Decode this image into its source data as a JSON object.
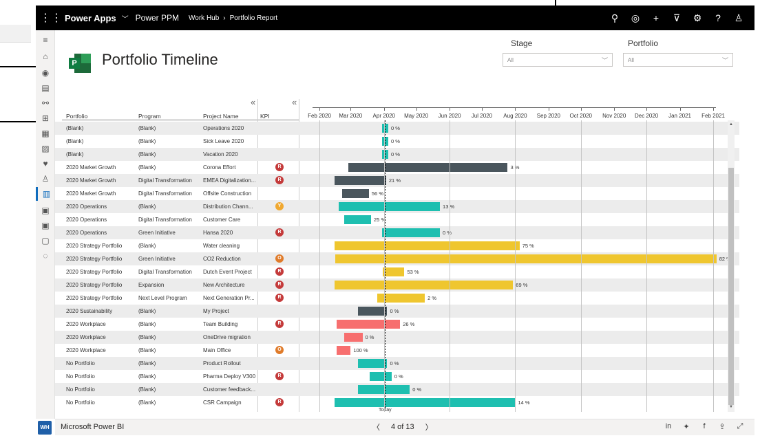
{
  "topbar": {
    "app_name": "Power Apps",
    "env_name": "Power PPM",
    "crumb_1": "Work Hub",
    "crumb_2": "Portfolio Report",
    "icons": [
      "search-icon",
      "assistant-icon",
      "add-icon",
      "filter-icon",
      "settings-icon",
      "help-icon",
      "user-icon"
    ]
  },
  "rail": {
    "avatar_initials": "WH",
    "items": [
      "hamburger-icon",
      "home-icon",
      "circle-icon",
      "document-icon",
      "hierarchy-icon",
      "table-icon",
      "grid-icon",
      "image-icon",
      "heart-icon",
      "person-icon",
      "report-icon",
      "clipboard-icon",
      "clipboard-icon",
      "page-icon",
      "check-circle-icon"
    ]
  },
  "report": {
    "title": "Portfolio Timeline",
    "stage_label": "Stage",
    "stage_value": "All",
    "portfolio_label": "Portfolio",
    "portfolio_value": "All",
    "headers": {
      "portfolio": "Portfolio",
      "program": "Program",
      "project": "Project Name",
      "kpi": "KPI"
    },
    "months": [
      "Feb 2020",
      "Mar 2020",
      "Apr 2020",
      "May 2020",
      "Jun 2020",
      "Jul 2020",
      "Aug 2020",
      "Sep 2020",
      "Oct 2020",
      "Nov 2020",
      "Dec 2020",
      "Jan 2021",
      "Feb 2021"
    ],
    "today_label": "Today",
    "colors": {
      "teal": "#1ebfb0",
      "dark": "#4a565d",
      "yellow": "#efc62f",
      "red": "#f76f6f",
      "kpi_red": "#c43a3a",
      "kpi_orange": "#e07b2a",
      "kpi_yellow": "#f0a830"
    },
    "rows": [
      {
        "portfolio": "(Blank)",
        "program": "(Blank)",
        "project": "Operations 2020",
        "kpi": "",
        "kpi_color": "",
        "color": "teal",
        "start": "2020-03-30",
        "end": "2020-04-05",
        "pct": "0 %"
      },
      {
        "portfolio": "(Blank)",
        "program": "(Blank)",
        "project": "Sick Leave 2020",
        "kpi": "",
        "kpi_color": "",
        "color": "teal",
        "start": "2020-03-30",
        "end": "2020-04-05",
        "pct": "0 %"
      },
      {
        "portfolio": "(Blank)",
        "program": "(Blank)",
        "project": "Vacation 2020",
        "kpi": "",
        "kpi_color": "",
        "color": "teal",
        "start": "2020-03-30",
        "end": "2020-04-05",
        "pct": "0 %"
      },
      {
        "portfolio": "2020 Market Growth",
        "program": "(Blank)",
        "project": "Corona Effort",
        "kpi": "R",
        "kpi_color": "kpi_red",
        "color": "dark",
        "start": "2020-02-28",
        "end": "2020-07-25",
        "pct": "3 %"
      },
      {
        "portfolio": "2020 Market Growth",
        "program": "Digital Transformation",
        "project": "EMEA Digitalization...",
        "kpi": "R",
        "kpi_color": "kpi_red",
        "color": "dark",
        "start": "2020-02-15",
        "end": "2020-04-03",
        "pct": "21 %"
      },
      {
        "portfolio": "2020 Market Growth",
        "program": "Digital Transformation",
        "project": "Offsite Construction",
        "kpi": "",
        "kpi_color": "",
        "color": "dark",
        "start": "2020-02-22",
        "end": "2020-03-18",
        "pct": "56 %"
      },
      {
        "portfolio": "2020 Operations",
        "program": "(Blank)",
        "project": "Distribution Chann...",
        "kpi": "Y",
        "kpi_color": "kpi_yellow",
        "color": "teal",
        "start": "2020-02-19",
        "end": "2020-05-23",
        "pct": "13 %"
      },
      {
        "portfolio": "2020 Operations",
        "program": "Digital Transformation",
        "project": "Customer Care",
        "kpi": "",
        "kpi_color": "",
        "color": "teal",
        "start": "2020-02-24",
        "end": "2020-03-20",
        "pct": "25 %"
      },
      {
        "portfolio": "2020 Operations",
        "program": "Green Initiative",
        "project": "Hansa 2020",
        "kpi": "R",
        "kpi_color": "kpi_red",
        "color": "teal",
        "start": "2020-03-30",
        "end": "2020-05-23",
        "pct": "0 %"
      },
      {
        "portfolio": "2020 Strategy Portfolio",
        "program": "(Blank)",
        "project": "Water cleaning",
        "kpi": "",
        "kpi_color": "",
        "color": "yellow",
        "start": "2020-02-15",
        "end": "2020-08-05",
        "pct": "75 %"
      },
      {
        "portfolio": "2020 Strategy Portfolio",
        "program": "Green Initiative",
        "project": "CO2 Reduction",
        "kpi": "O",
        "kpi_color": "kpi_orange",
        "color": "yellow",
        "start": "2020-02-16",
        "end": "2021-02-04",
        "pct": "82 %"
      },
      {
        "portfolio": "2020 Strategy Portfolio",
        "program": "Digital Transformation",
        "project": "Dutch Event Project",
        "kpi": "R",
        "kpi_color": "kpi_red",
        "color": "yellow",
        "start": "2020-03-31",
        "end": "2020-04-20",
        "pct": "53 %"
      },
      {
        "portfolio": "2020 Strategy Portfolio",
        "program": "Expansion",
        "project": "New Architecture",
        "kpi": "R",
        "kpi_color": "kpi_red",
        "color": "yellow",
        "start": "2020-02-15",
        "end": "2020-07-30",
        "pct": "69 %"
      },
      {
        "portfolio": "2020 Strategy Portfolio",
        "program": "Next Level Program",
        "project": "Next Generation Pr...",
        "kpi": "R",
        "kpi_color": "kpi_red",
        "color": "yellow",
        "start": "2020-03-26",
        "end": "2020-05-09",
        "pct": "2 %"
      },
      {
        "portfolio": "2020 Sustainability",
        "program": "(Blank)",
        "project": "My Project",
        "kpi": "",
        "kpi_color": "",
        "color": "dark",
        "start": "2020-03-08",
        "end": "2020-04-04",
        "pct": "0 %"
      },
      {
        "portfolio": "2020 Workplace",
        "program": "(Blank)",
        "project": "Team Building",
        "kpi": "R",
        "kpi_color": "kpi_red",
        "color": "red",
        "start": "2020-02-17",
        "end": "2020-04-16",
        "pct": "26 %"
      },
      {
        "portfolio": "2020 Workplace",
        "program": "(Blank)",
        "project": "OneDrive migration",
        "kpi": "",
        "kpi_color": "",
        "color": "red",
        "start": "2020-02-24",
        "end": "2020-03-12",
        "pct": "0 %"
      },
      {
        "portfolio": "2020 Workplace",
        "program": "(Blank)",
        "project": "Main Office",
        "kpi": "O",
        "kpi_color": "kpi_orange",
        "color": "red",
        "start": "2020-02-17",
        "end": "2020-03-01",
        "pct": "100 %"
      },
      {
        "portfolio": "No Portfolio",
        "program": "(Blank)",
        "project": "Product Rollout",
        "kpi": "",
        "kpi_color": "",
        "color": "teal",
        "start": "2020-03-08",
        "end": "2020-04-04",
        "pct": "0 %"
      },
      {
        "portfolio": "No Portfolio",
        "program": "(Blank)",
        "project": "Pharma Deploy V300",
        "kpi": "R",
        "kpi_color": "kpi_red",
        "color": "teal",
        "start": "2020-03-19",
        "end": "2020-04-08",
        "pct": "0 %"
      },
      {
        "portfolio": "No Portfolio",
        "program": "(Blank)",
        "project": "Customer feedback...",
        "kpi": "",
        "kpi_color": "",
        "color": "teal",
        "start": "2020-03-08",
        "end": "2020-04-25",
        "pct": "0 %"
      },
      {
        "portfolio": "No Portfolio",
        "program": "(Blank)",
        "project": "CSR Campaign",
        "kpi": "R",
        "kpi_color": "kpi_red",
        "color": "teal",
        "start": "2020-02-15",
        "end": "2020-08-01",
        "pct": "14 %"
      }
    ]
  },
  "bottombar": {
    "app_name": "Microsoft Power BI",
    "page_indicator": "4 of 13",
    "prev_glyph": "〈",
    "next_glyph": "〉",
    "icons": [
      "linkedin-icon",
      "twitter-icon",
      "facebook-icon",
      "share-icon",
      "expand-icon"
    ]
  }
}
